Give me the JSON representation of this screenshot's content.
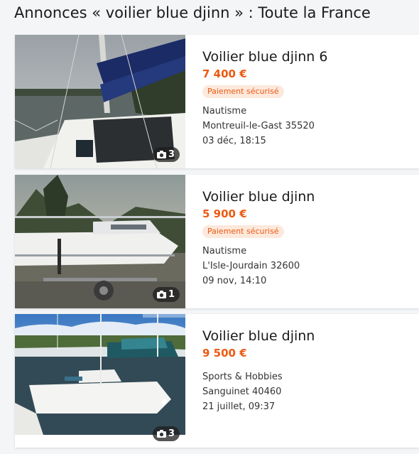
{
  "header": {
    "title": "Annonces « voilier blue djinn » : Toute la France"
  },
  "listings": [
    {
      "title": "Voilier blue djinn 6",
      "price": "7 400 €",
      "badge": "Paiement sécurisé",
      "category": "Nautisme",
      "location": "Montreuil-le-Gast 35520",
      "date": "03 déc, 18:15",
      "photo_count": "3"
    },
    {
      "title": "Voilier blue djinn",
      "price": "5 900 €",
      "badge": "Paiement sécurisé",
      "category": "Nautisme",
      "location": "L'Isle-Jourdain 32600",
      "date": "09 nov, 14:10",
      "photo_count": "1"
    },
    {
      "title": "Voilier blue djinn",
      "price": "9 500 €",
      "badge": "",
      "category": "Sports & Hobbies",
      "location": "Sanguinet 40460",
      "date": "21 juillet, 09:37",
      "photo_count": "3"
    }
  ],
  "icons": {
    "photo_count_icon": "camera-icon"
  },
  "colors": {
    "price": "#ec5a13",
    "badge_bg": "#fde8dc",
    "page_bg": "#f4f5f7"
  }
}
